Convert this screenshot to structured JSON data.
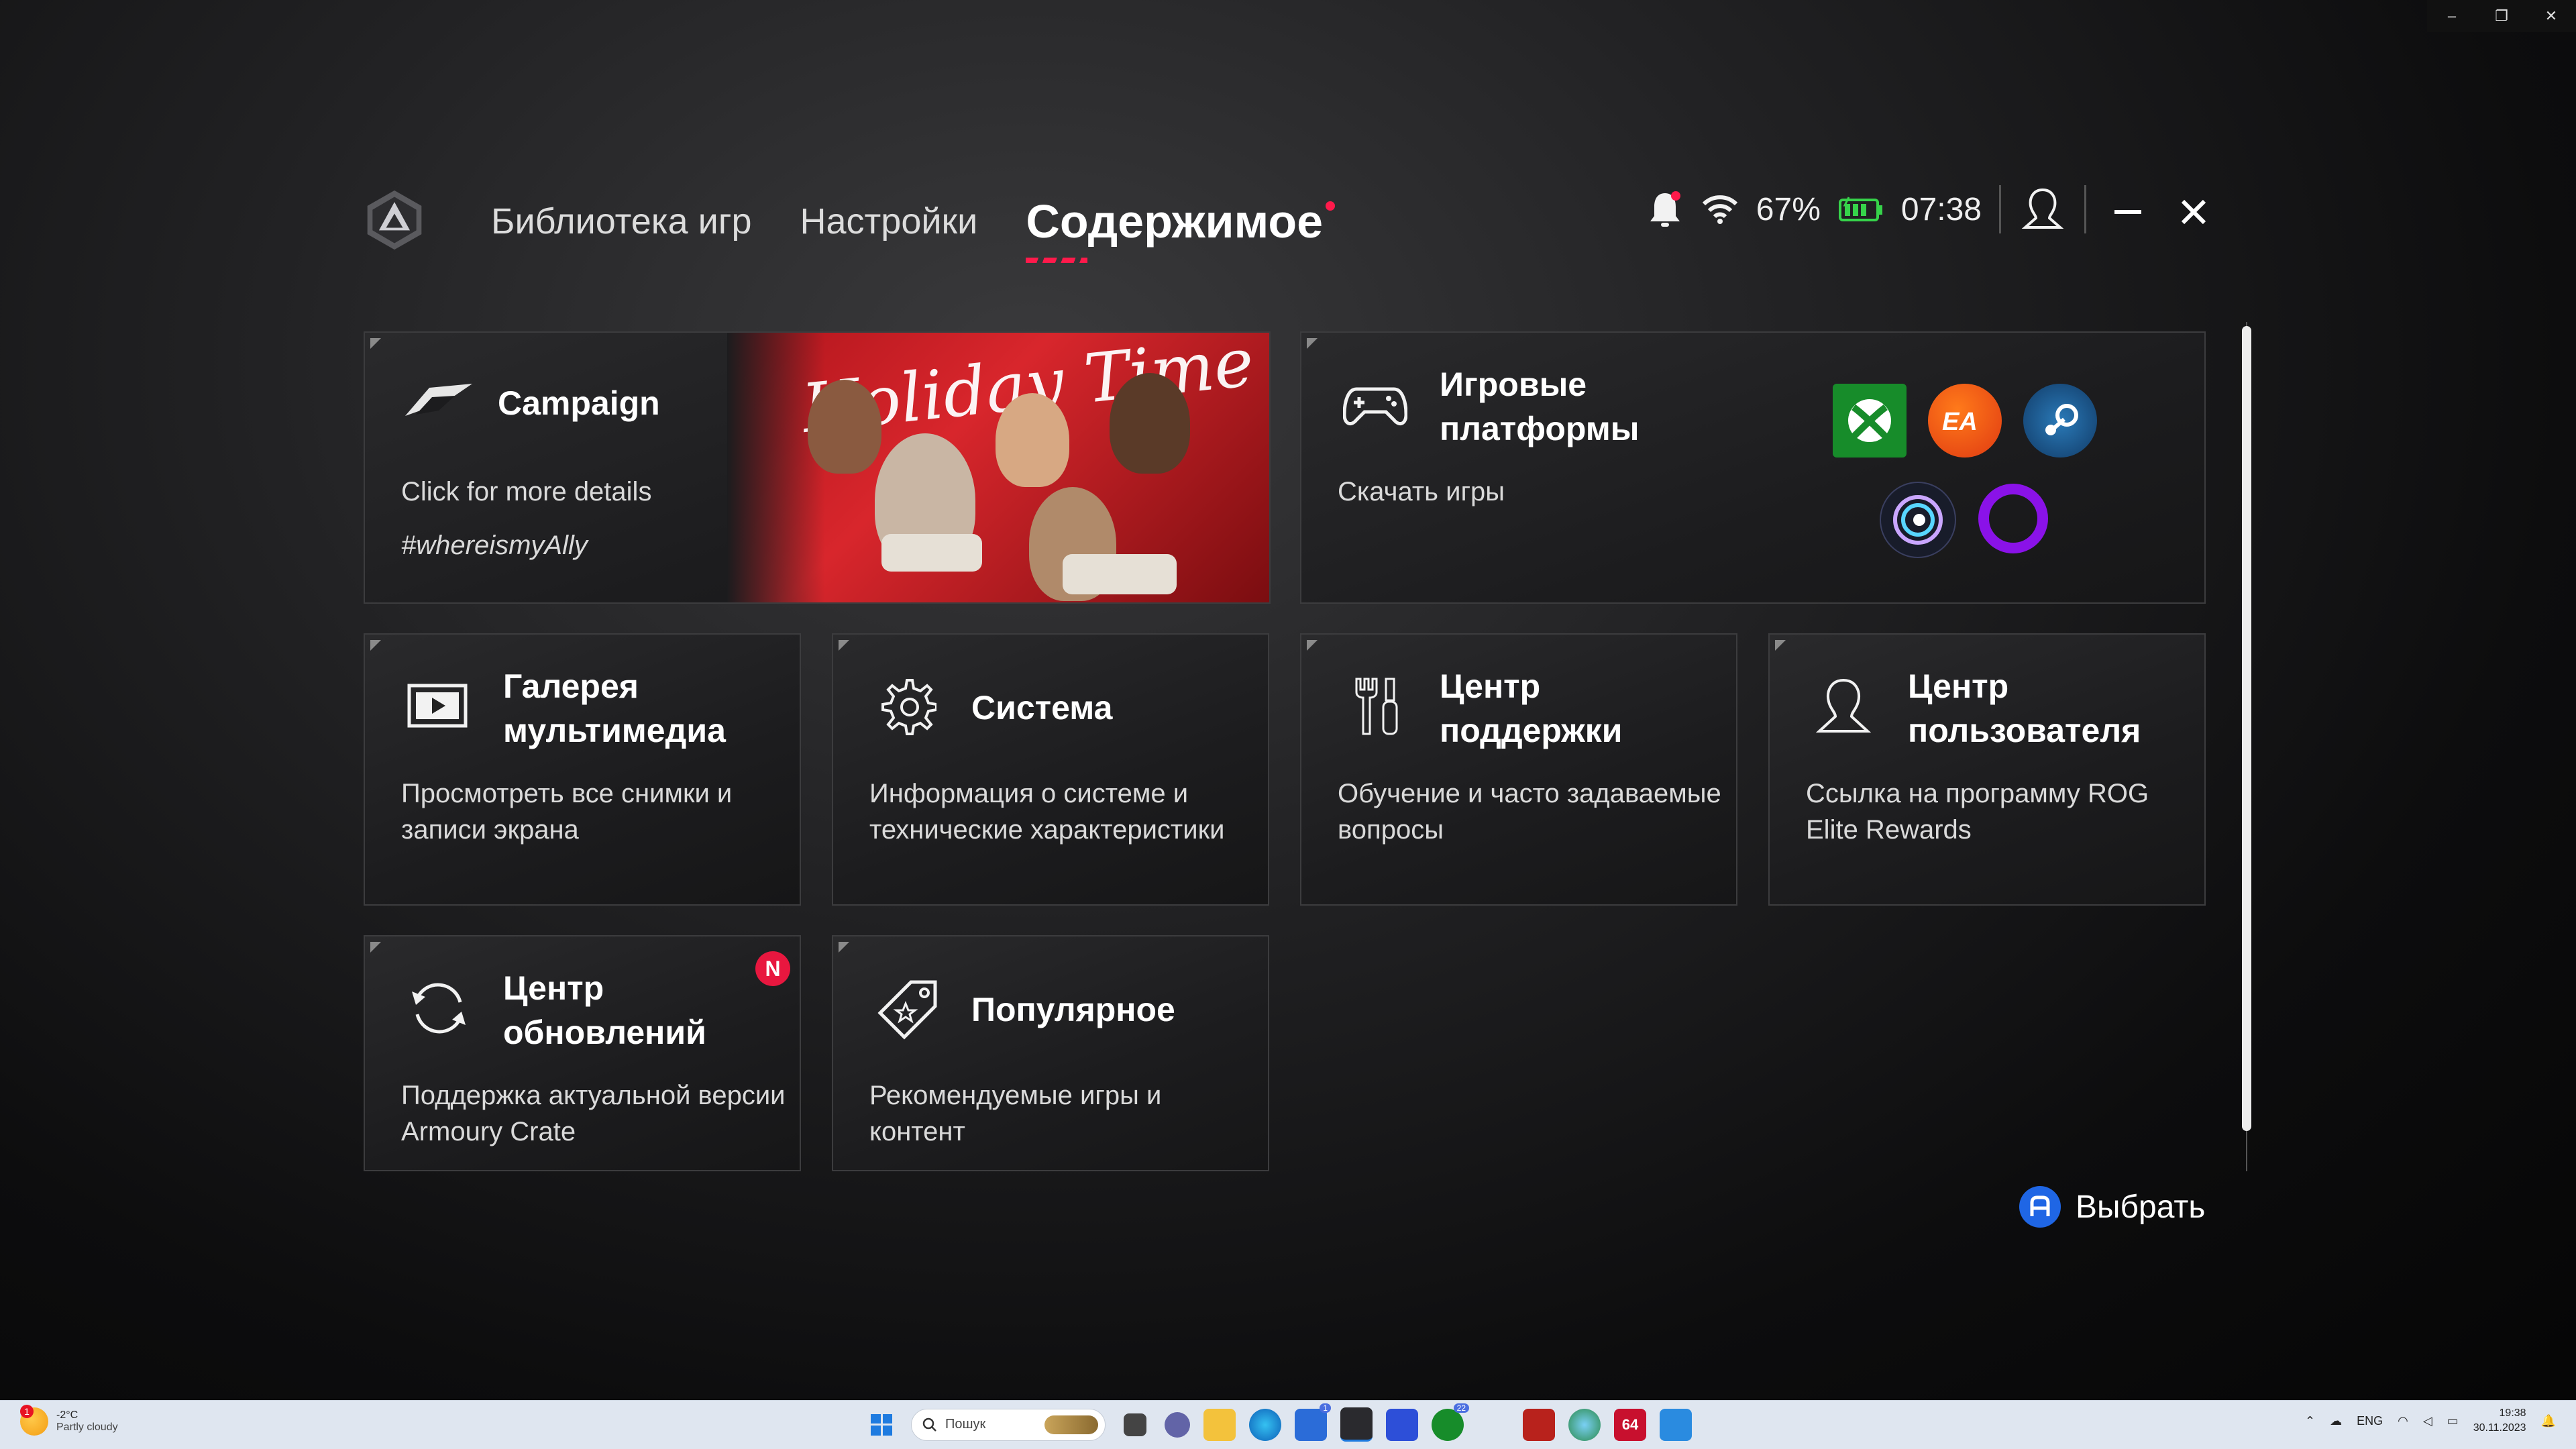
{
  "window": {
    "controls": [
      "–",
      "❐",
      "✕"
    ]
  },
  "header": {
    "tabs": [
      {
        "label": "Библиотека игр",
        "active": false
      },
      {
        "label": "Настройки",
        "active": false
      },
      {
        "label": "Содержимое",
        "active": true
      }
    ],
    "battery": "67%",
    "time": "07:38",
    "accent": "#ff1a4b"
  },
  "cards": {
    "campaign": {
      "title": "Campaign",
      "desc": "Click for more details",
      "hashtag": "#whereismyAlly",
      "banner": "Holiday Time"
    },
    "platforms": {
      "title": "Игровые платформы",
      "desc": "Скачать игры",
      "logos": [
        "xbox",
        "ea",
        "steam",
        "ubisoft",
        "origin"
      ]
    },
    "gallery": {
      "title": "Галерея мультимедиа",
      "desc": "Просмотреть все снимки и записи экрана"
    },
    "system": {
      "title": "Система",
      "desc": "Информация о системе и технические характеристики"
    },
    "support": {
      "title": "Центр поддержки",
      "desc": "Обучение и часто задаваемые вопросы"
    },
    "user": {
      "title": "Центр пользователя",
      "desc": "Ссылка на программу ROG Elite Rewards"
    },
    "update": {
      "title": "Центр обновлений",
      "desc": "Поддержка актуальной версии Armoury Crate",
      "badge": "N"
    },
    "popular": {
      "title": "Популярное",
      "desc": "Рекомендуемые игры и контент"
    }
  },
  "select_hint": {
    "label": "Выбрать",
    "button": "A"
  },
  "taskbar": {
    "weather_temp": "-2°C",
    "weather_desc": "Partly cloudy",
    "weather_badge": "1",
    "search_placeholder": "Пошук",
    "lang": "ENG",
    "clock_time": "19:38",
    "clock_date": "30.11.2023",
    "app_badge_1": "1",
    "app_badge_2": "22",
    "app_64": "64"
  }
}
